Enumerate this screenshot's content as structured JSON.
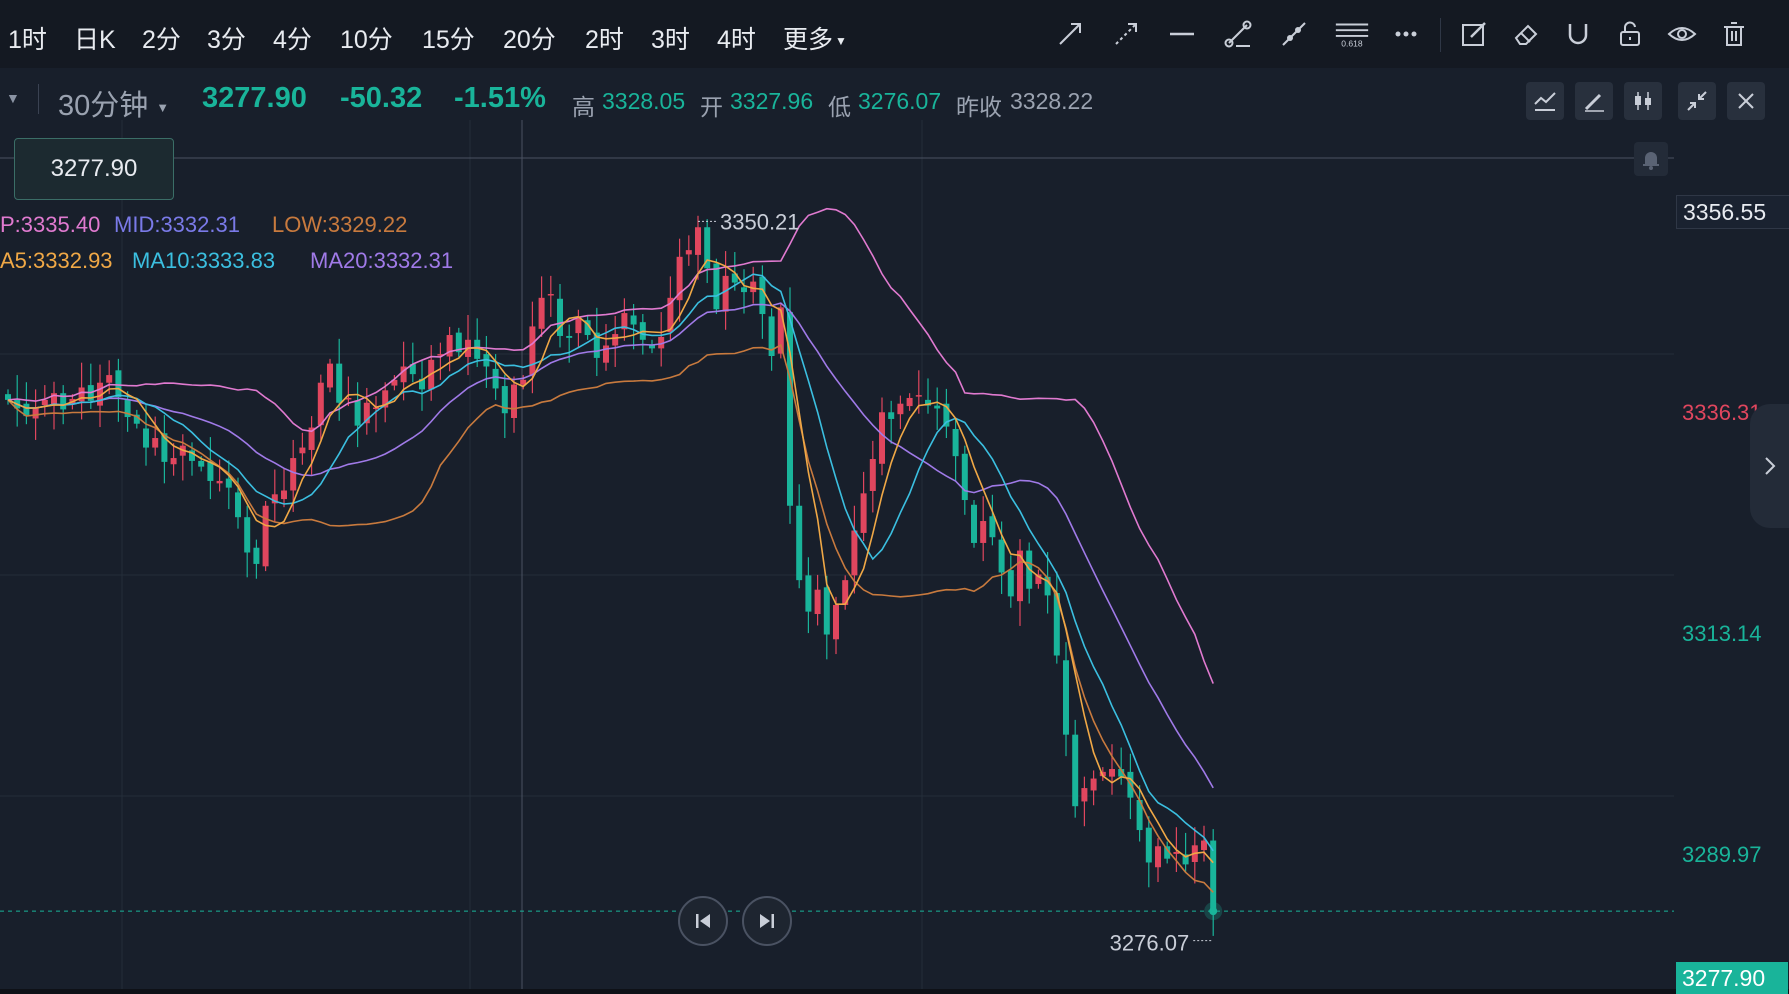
{
  "toolbar": {
    "intervals": [
      "1时",
      "日K",
      "2分",
      "3分",
      "4分",
      "10分",
      "15分",
      "20分",
      "2时",
      "3时",
      "4时",
      "更多"
    ],
    "fib_label": "0.618"
  },
  "info": {
    "timeframe": "30分钟",
    "last": "3277.90",
    "change": "-50.32",
    "change_pct": "-1.51%",
    "high_label": "高",
    "high": "3328.05",
    "open_label": "开",
    "open": "3327.96",
    "low_label": "低",
    "low": "3276.07",
    "prev_close_label": "昨收",
    "prev_close": "3328.22"
  },
  "cursor_price": "3277.90",
  "legends": {
    "boll_up": "P:3335.40",
    "boll_mid": "MID:3332.31",
    "boll_low": "LOW:3329.22",
    "ma5": "A5:3332.93",
    "ma10": "MA10:3333.83",
    "ma20": "MA20:3332.31"
  },
  "price_axis": {
    "crosshair_price": "3356.55",
    "ticks": [
      "3336.31",
      "3313.14",
      "3289.97"
    ],
    "last_price": "3277.90"
  },
  "annotations": {
    "max_label": "3350.21",
    "min_label": "3276.07"
  },
  "colors": {
    "up": "#e0465e",
    "down": "#19b49a",
    "ma5": "#f0a846",
    "ma10": "#3bbfe0",
    "ma20": "#a07ae8",
    "boll_up": "#e07ad0",
    "boll_mid": "#7a7ae8",
    "boll_low": "#c87a3e"
  },
  "chart_data": {
    "type": "line",
    "title": "",
    "y_ticks": [
      3289.97,
      3313.14,
      3336.31
    ],
    "ylim": [
      3262,
      3362
    ],
    "candles_close": [
      3331.5,
      3330.6,
      3329.8,
      3330.7,
      3331.5,
      3332.2,
      3330.5,
      3331.6,
      3332.8,
      3331.4,
      3333.3,
      3334.1,
      3331.8,
      3329.7,
      3329.0,
      3326.5,
      3327.5,
      3325.0,
      3325.4,
      3326.7,
      3325.1,
      3324.5,
      3323.0,
      3323.0,
      3322.3,
      3319.2,
      3315.5,
      3314.3,
      3320.4,
      3321.6,
      3322.0,
      3325.4,
      3326.5,
      3328.6,
      3333.3,
      3335.3,
      3331.2,
      3331.7,
      3328.8,
      3331.2,
      3330.7,
      3332.5,
      3333.6,
      3335.0,
      3334.2,
      3332.6,
      3335.7,
      3336.3,
      3338.3,
      3336.5,
      3337.8,
      3335.8,
      3335.0,
      3332.7,
      3330.1,
      3333.1,
      3333.6,
      3339.2,
      3342.2,
      3342.6,
      3338.2,
      3338.0,
      3340.1,
      3338.3,
      3335.9,
      3337.2,
      3338.4,
      3340.6,
      3339.4,
      3337.8,
      3336.9,
      3338.1,
      3342.2,
      3346.5,
      3347.2,
      3349.6,
      3345.3,
      3341.0,
      3344.5,
      3343.8,
      3342.8,
      3343.9,
      3340.5,
      3336.1,
      3341.2,
      3320.4,
      3312.6,
      3309.3,
      3311.6,
      3306.9,
      3310.0,
      3312.6,
      3317.8,
      3321.7,
      3325.3,
      3330.2,
      3329.5,
      3331.1,
      3331.7,
      3332.0,
      3330.9,
      3330.6,
      3328.7,
      3325.6,
      3321.0,
      3316.5,
      3318.8,
      3317.1,
      3313.4,
      3310.9,
      3315.7,
      3311.7,
      3313.2,
      3311.0,
      3304.7,
      3296.4,
      3288.9,
      3290.8,
      3291.8,
      3292.5,
      3292.8,
      3292.0,
      3289.8,
      3286.4,
      3283.0,
      3284.7,
      3283.4,
      3284.1,
      3282.8,
      3284.8,
      3285.3,
      3277.9
    ],
    "series": [
      {
        "name": "MA5",
        "values": [
          3332.9
        ]
      },
      {
        "name": "MA10",
        "values": [
          3333.8
        ]
      },
      {
        "name": "MA20",
        "values": [
          3332.3
        ]
      }
    ],
    "last_price": 3277.9,
    "high": 3350.21,
    "low": 3276.07
  }
}
